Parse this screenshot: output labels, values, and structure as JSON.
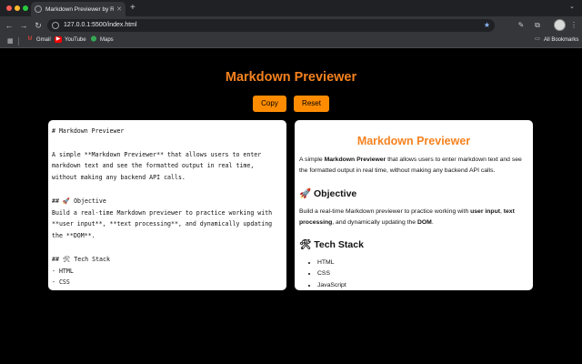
{
  "browser": {
    "tab_title": "Markdown Previewer by Renil",
    "url": "127.0.0.1:5500/index.html",
    "bookmarks": [
      {
        "label": "Gmail",
        "icon": "gmail-icon"
      },
      {
        "label": "YouTube",
        "icon": "youtube-icon"
      },
      {
        "label": "Maps",
        "icon": "maps-icon"
      }
    ],
    "all_bookmarks": "All Bookmarks"
  },
  "app": {
    "title": "Markdown Previewer",
    "copy_label": "Copy",
    "reset_label": "Reset",
    "editor_text": "# Markdown Previewer\n\nA simple **Markdown Previewer** that allows users to enter markdown text and see the formatted output in real time, without making any backend API calls.\n\n## 🚀 Objective\nBuild a real-time Markdown previewer to practice working with **user input**, **text processing**, and dynamically updating the **DOM**.\n\n## 🛠 Tech Stack\n- HTML\n- CSS\n- JavaScript"
  },
  "preview": {
    "h1": "Markdown Previewer",
    "p1": {
      "a": "A simple ",
      "b": "Markdown Previewer",
      "c": " that allows users to enter markdown text and see the formatted output in real time, without making any backend API calls."
    },
    "h2_objective": "🚀 Objective",
    "p2": {
      "a": "Build a real-time Markdown previewer to practice working with ",
      "b1": "user input",
      "c1": ", ",
      "b2": "text processing",
      "c2": ", and dynamically updating the ",
      "b3": "DOM",
      "c3": "."
    },
    "h2_tech": "🛠 Tech Stack",
    "tech_list": [
      "HTML",
      "CSS",
      "JavaScript"
    ]
  }
}
